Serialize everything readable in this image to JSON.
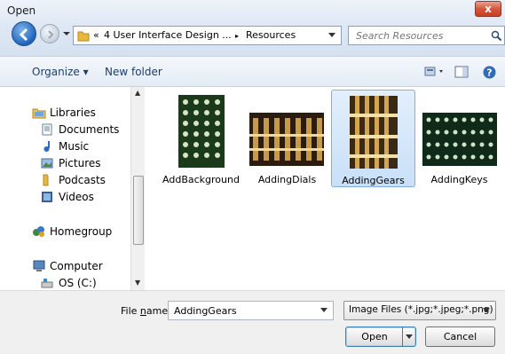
{
  "window": {
    "title": "Open",
    "close_label": "x"
  },
  "address": {
    "overflow": "«",
    "crumbs": [
      "4 User Interface Design ...",
      "Resources"
    ],
    "separator": "▸"
  },
  "search": {
    "placeholder": "Search Resources"
  },
  "toolbar": {
    "organize_label": "Organize ▾",
    "new_folder_label": "New folder"
  },
  "sidebar": {
    "items": [
      {
        "label": "Libraries",
        "icon": "libraries-icon"
      },
      {
        "label": "Documents",
        "icon": "documents-icon"
      },
      {
        "label": "Music",
        "icon": "music-icon"
      },
      {
        "label": "Pictures",
        "icon": "pictures-icon"
      },
      {
        "label": "Podcasts",
        "icon": "podcasts-icon"
      },
      {
        "label": "Videos",
        "icon": "videos-icon"
      },
      {
        "label": "Homegroup",
        "icon": "homegroup-icon"
      },
      {
        "label": "Computer",
        "icon": "computer-icon"
      },
      {
        "label": "OS (C:)",
        "icon": "drive-icon"
      }
    ]
  },
  "files": [
    {
      "name": "AddBackground",
      "selected": false
    },
    {
      "name": "AddingDials",
      "selected": false
    },
    {
      "name": "AddingGears",
      "selected": true
    },
    {
      "name": "AddingKeys",
      "selected": false
    }
  ],
  "footer": {
    "file_name_label_pre": "File ",
    "file_name_label_u": "n",
    "file_name_label_post": "ame:",
    "file_name_value": "AddingGears",
    "file_type": "Image Files (*.jpg;*.jpeg;*.png)",
    "open_label": "Open",
    "cancel_label": "Cancel"
  },
  "colors": {
    "accent": "#1f63b9",
    "selection": "#c9e0f8"
  }
}
